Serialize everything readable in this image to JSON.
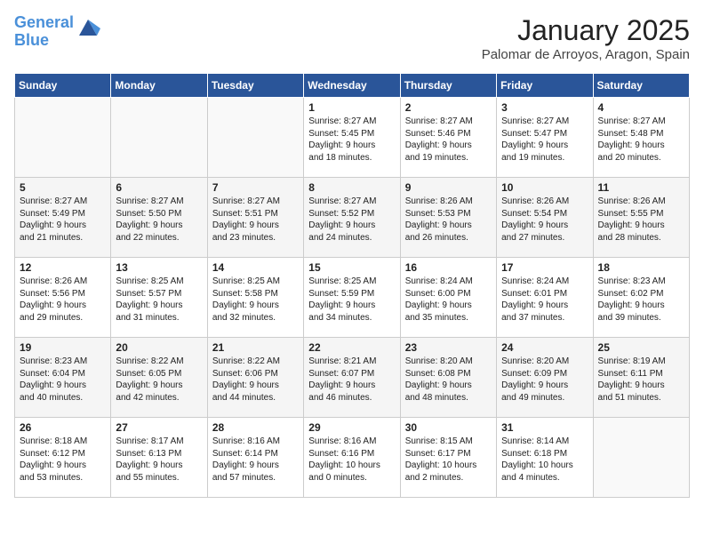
{
  "header": {
    "logo_line1": "General",
    "logo_line2": "Blue",
    "title": "January 2025",
    "subtitle": "Palomar de Arroyos, Aragon, Spain"
  },
  "weekdays": [
    "Sunday",
    "Monday",
    "Tuesday",
    "Wednesday",
    "Thursday",
    "Friday",
    "Saturday"
  ],
  "weeks": [
    [
      {
        "day": "",
        "content": ""
      },
      {
        "day": "",
        "content": ""
      },
      {
        "day": "",
        "content": ""
      },
      {
        "day": "1",
        "content": "Sunrise: 8:27 AM\nSunset: 5:45 PM\nDaylight: 9 hours\nand 18 minutes."
      },
      {
        "day": "2",
        "content": "Sunrise: 8:27 AM\nSunset: 5:46 PM\nDaylight: 9 hours\nand 19 minutes."
      },
      {
        "day": "3",
        "content": "Sunrise: 8:27 AM\nSunset: 5:47 PM\nDaylight: 9 hours\nand 19 minutes."
      },
      {
        "day": "4",
        "content": "Sunrise: 8:27 AM\nSunset: 5:48 PM\nDaylight: 9 hours\nand 20 minutes."
      }
    ],
    [
      {
        "day": "5",
        "content": "Sunrise: 8:27 AM\nSunset: 5:49 PM\nDaylight: 9 hours\nand 21 minutes."
      },
      {
        "day": "6",
        "content": "Sunrise: 8:27 AM\nSunset: 5:50 PM\nDaylight: 9 hours\nand 22 minutes."
      },
      {
        "day": "7",
        "content": "Sunrise: 8:27 AM\nSunset: 5:51 PM\nDaylight: 9 hours\nand 23 minutes."
      },
      {
        "day": "8",
        "content": "Sunrise: 8:27 AM\nSunset: 5:52 PM\nDaylight: 9 hours\nand 24 minutes."
      },
      {
        "day": "9",
        "content": "Sunrise: 8:26 AM\nSunset: 5:53 PM\nDaylight: 9 hours\nand 26 minutes."
      },
      {
        "day": "10",
        "content": "Sunrise: 8:26 AM\nSunset: 5:54 PM\nDaylight: 9 hours\nand 27 minutes."
      },
      {
        "day": "11",
        "content": "Sunrise: 8:26 AM\nSunset: 5:55 PM\nDaylight: 9 hours\nand 28 minutes."
      }
    ],
    [
      {
        "day": "12",
        "content": "Sunrise: 8:26 AM\nSunset: 5:56 PM\nDaylight: 9 hours\nand 29 minutes."
      },
      {
        "day": "13",
        "content": "Sunrise: 8:25 AM\nSunset: 5:57 PM\nDaylight: 9 hours\nand 31 minutes."
      },
      {
        "day": "14",
        "content": "Sunrise: 8:25 AM\nSunset: 5:58 PM\nDaylight: 9 hours\nand 32 minutes."
      },
      {
        "day": "15",
        "content": "Sunrise: 8:25 AM\nSunset: 5:59 PM\nDaylight: 9 hours\nand 34 minutes."
      },
      {
        "day": "16",
        "content": "Sunrise: 8:24 AM\nSunset: 6:00 PM\nDaylight: 9 hours\nand 35 minutes."
      },
      {
        "day": "17",
        "content": "Sunrise: 8:24 AM\nSunset: 6:01 PM\nDaylight: 9 hours\nand 37 minutes."
      },
      {
        "day": "18",
        "content": "Sunrise: 8:23 AM\nSunset: 6:02 PM\nDaylight: 9 hours\nand 39 minutes."
      }
    ],
    [
      {
        "day": "19",
        "content": "Sunrise: 8:23 AM\nSunset: 6:04 PM\nDaylight: 9 hours\nand 40 minutes."
      },
      {
        "day": "20",
        "content": "Sunrise: 8:22 AM\nSunset: 6:05 PM\nDaylight: 9 hours\nand 42 minutes."
      },
      {
        "day": "21",
        "content": "Sunrise: 8:22 AM\nSunset: 6:06 PM\nDaylight: 9 hours\nand 44 minutes."
      },
      {
        "day": "22",
        "content": "Sunrise: 8:21 AM\nSunset: 6:07 PM\nDaylight: 9 hours\nand 46 minutes."
      },
      {
        "day": "23",
        "content": "Sunrise: 8:20 AM\nSunset: 6:08 PM\nDaylight: 9 hours\nand 48 minutes."
      },
      {
        "day": "24",
        "content": "Sunrise: 8:20 AM\nSunset: 6:09 PM\nDaylight: 9 hours\nand 49 minutes."
      },
      {
        "day": "25",
        "content": "Sunrise: 8:19 AM\nSunset: 6:11 PM\nDaylight: 9 hours\nand 51 minutes."
      }
    ],
    [
      {
        "day": "26",
        "content": "Sunrise: 8:18 AM\nSunset: 6:12 PM\nDaylight: 9 hours\nand 53 minutes."
      },
      {
        "day": "27",
        "content": "Sunrise: 8:17 AM\nSunset: 6:13 PM\nDaylight: 9 hours\nand 55 minutes."
      },
      {
        "day": "28",
        "content": "Sunrise: 8:16 AM\nSunset: 6:14 PM\nDaylight: 9 hours\nand 57 minutes."
      },
      {
        "day": "29",
        "content": "Sunrise: 8:16 AM\nSunset: 6:16 PM\nDaylight: 10 hours\nand 0 minutes."
      },
      {
        "day": "30",
        "content": "Sunrise: 8:15 AM\nSunset: 6:17 PM\nDaylight: 10 hours\nand 2 minutes."
      },
      {
        "day": "31",
        "content": "Sunrise: 8:14 AM\nSunset: 6:18 PM\nDaylight: 10 hours\nand 4 minutes."
      },
      {
        "day": "",
        "content": ""
      }
    ]
  ]
}
